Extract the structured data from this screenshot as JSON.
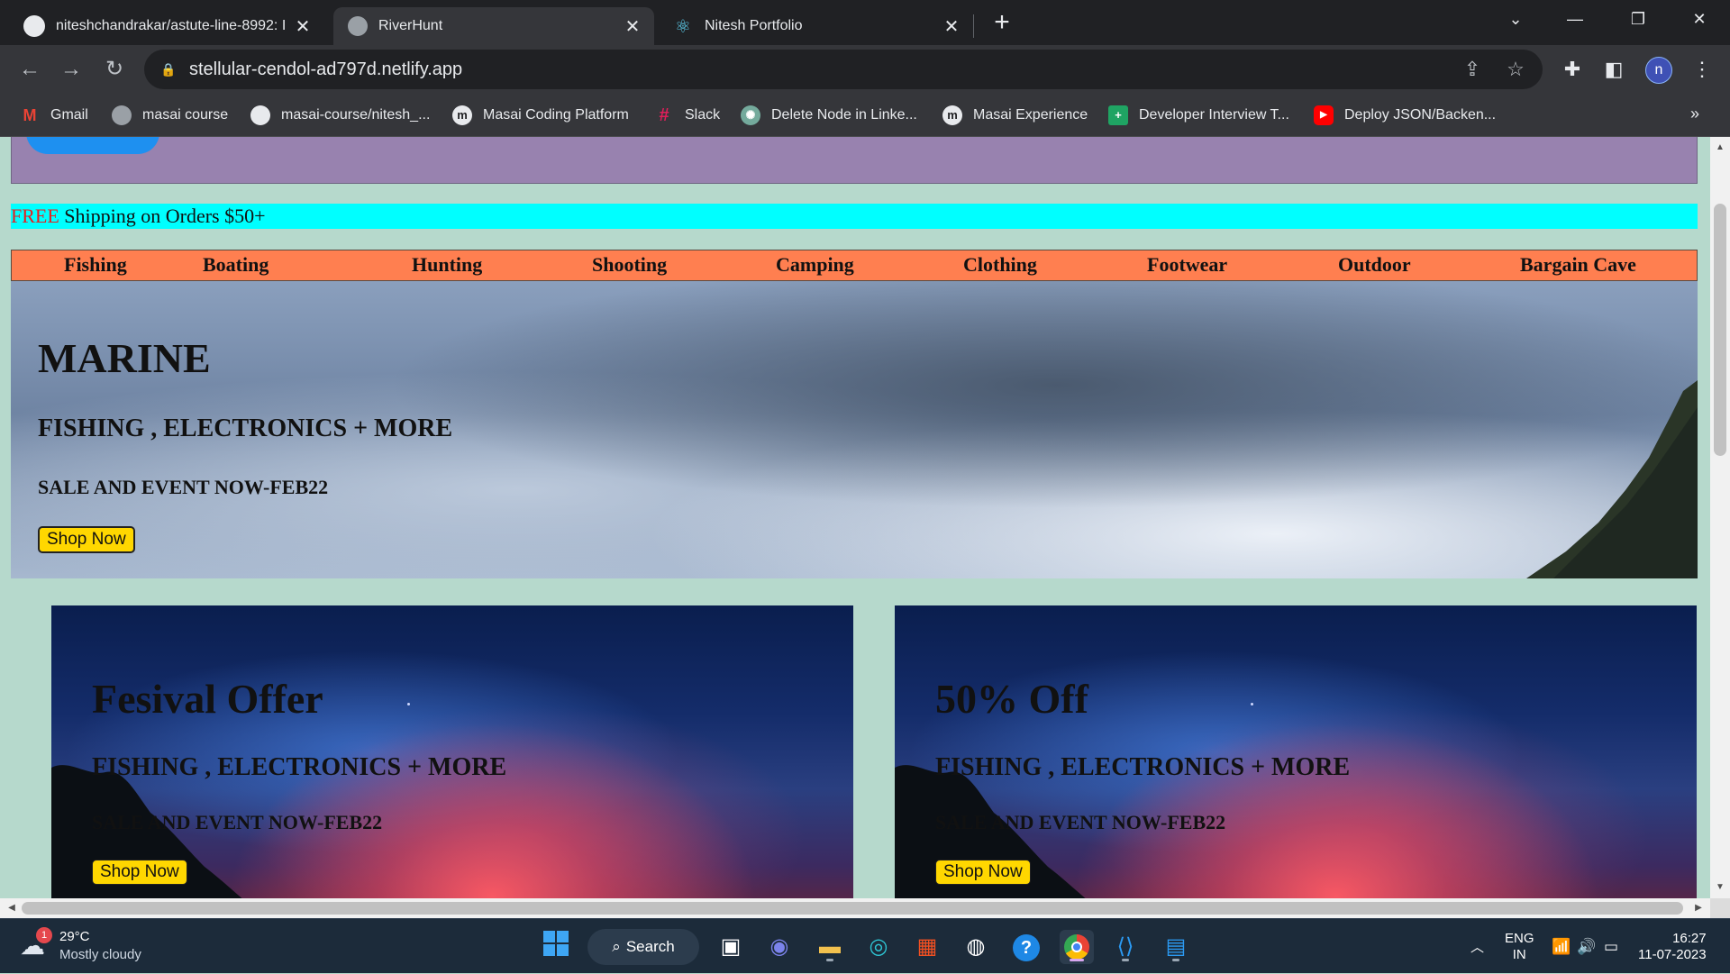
{
  "browser": {
    "tabs": [
      {
        "title": "niteshchandrakar/astute-line-8992: I",
        "icon": "github-icon",
        "active": false
      },
      {
        "title": "RiverHunt",
        "icon": "globe-icon",
        "active": true
      },
      {
        "title": "Nitesh Portfolio",
        "icon": "react-icon",
        "active": false
      }
    ],
    "url": "stellular-cendol-ad797d.netlify.app",
    "profile_initial": "n",
    "bookmarks": [
      {
        "label": "Gmail",
        "icon": "gmail-icon"
      },
      {
        "label": "masai course",
        "icon": "globe-icon"
      },
      {
        "label": "masai-course/nitesh_...",
        "icon": "github-icon"
      },
      {
        "label": "Masai Coding Platform",
        "icon": "masai-icon"
      },
      {
        "label": "Slack",
        "icon": "slack-icon"
      },
      {
        "label": "Delete Node in Linke...",
        "icon": "openai-icon"
      },
      {
        "label": "Masai Experience",
        "icon": "masai-icon"
      },
      {
        "label": "Developer Interview T...",
        "icon": "sheets-icon"
      },
      {
        "label": "Deploy JSON/Backen...",
        "icon": "youtube-icon"
      }
    ]
  },
  "page": {
    "shipping": {
      "free": "FREE",
      "rest": " Shipping on Orders $50+"
    },
    "menu": [
      "Fishing",
      "Boating",
      "Hunting",
      "Shooting",
      "Camping",
      "Clothing",
      "Footwear",
      "Outdoor",
      "Bargain Cave"
    ],
    "hero": {
      "title": "MARINE",
      "subtitle": "FISHING , ELECTRONICS + MORE",
      "event": "SALE AND EVENT NOW-FEB22",
      "button": "Shop Now"
    },
    "cards": [
      {
        "title": "Fesival Offer",
        "subtitle": "FISHING , ELECTRONICS + MORE",
        "event": "SALE AND EVENT NOW-FEB22",
        "button": "Shop Now"
      },
      {
        "title": "50% Off",
        "subtitle": "FISHING , ELECTRONICS + MORE",
        "event": "SALE AND EVENT NOW-FEB22",
        "button": "Shop Now"
      }
    ]
  },
  "taskbar": {
    "weather": {
      "temp": "29°C",
      "condition": "Mostly cloudy",
      "badge": "1"
    },
    "search_label": "Search",
    "lang_top": "ENG",
    "lang_bottom": "IN",
    "time": "16:27",
    "date": "11-07-2023"
  }
}
